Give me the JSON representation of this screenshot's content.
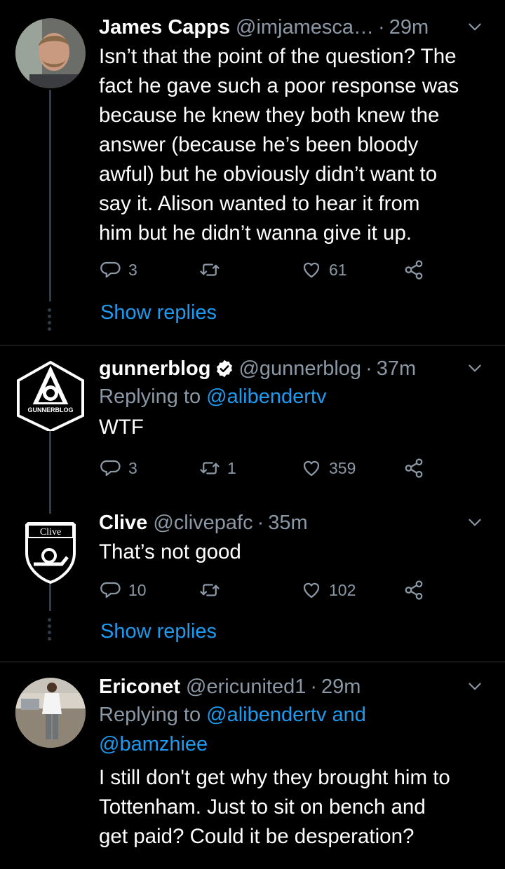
{
  "tweets": [
    {
      "name": "James Capps",
      "handle": "@imjamesca…",
      "time": "29m",
      "text_lines": [
        "Isn’t that the point of the question? The",
        "fact he gave such a poor response was",
        "because he knew they both knew the",
        "answer (because he’s been bloody",
        "awful) but he obviously didn’t want to",
        "say it. Alison wanted to hear it from",
        "him but he didn’t wanna give it up."
      ],
      "replies": "3",
      "retweets": "",
      "likes": "61",
      "show_replies": "Show replies",
      "avatar": "person-photo"
    },
    {
      "name": "gunnerblog",
      "handle": "@gunnerblog",
      "time": "37m",
      "replying_prefix": "Replying to",
      "replying_to": "@alibendertv",
      "text_lines": [
        "WTF"
      ],
      "replies": "3",
      "retweets": "1",
      "likes": "359",
      "avatar": "gunnerblog-logo",
      "avatar_label": "GUNNERBLOG",
      "verified": true
    },
    {
      "name": "Clive",
      "handle": "@clivepafc",
      "time": "35m",
      "text_lines": [
        "That’s not good"
      ],
      "replies": "10",
      "retweets": "",
      "likes": "102",
      "show_replies": "Show replies",
      "avatar": "arsenal-crest",
      "avatar_label": "Clive"
    },
    {
      "name": "Ericonet",
      "handle": "@ericunited1",
      "time": "29m",
      "replying_prefix": "Replying to",
      "replying_to_line1": "@alibendertv and",
      "replying_to_line2": "@bamzhiee",
      "text_lines": [
        "I still don't get why they brought him to",
        "Tottenham. Just to sit on bench and",
        "get paid? Could it be desperation?"
      ],
      "avatar": "person-photo"
    }
  ],
  "colors": {
    "accent": "#1d9bf0",
    "muted": "#8b98a5",
    "background": "#000000"
  }
}
